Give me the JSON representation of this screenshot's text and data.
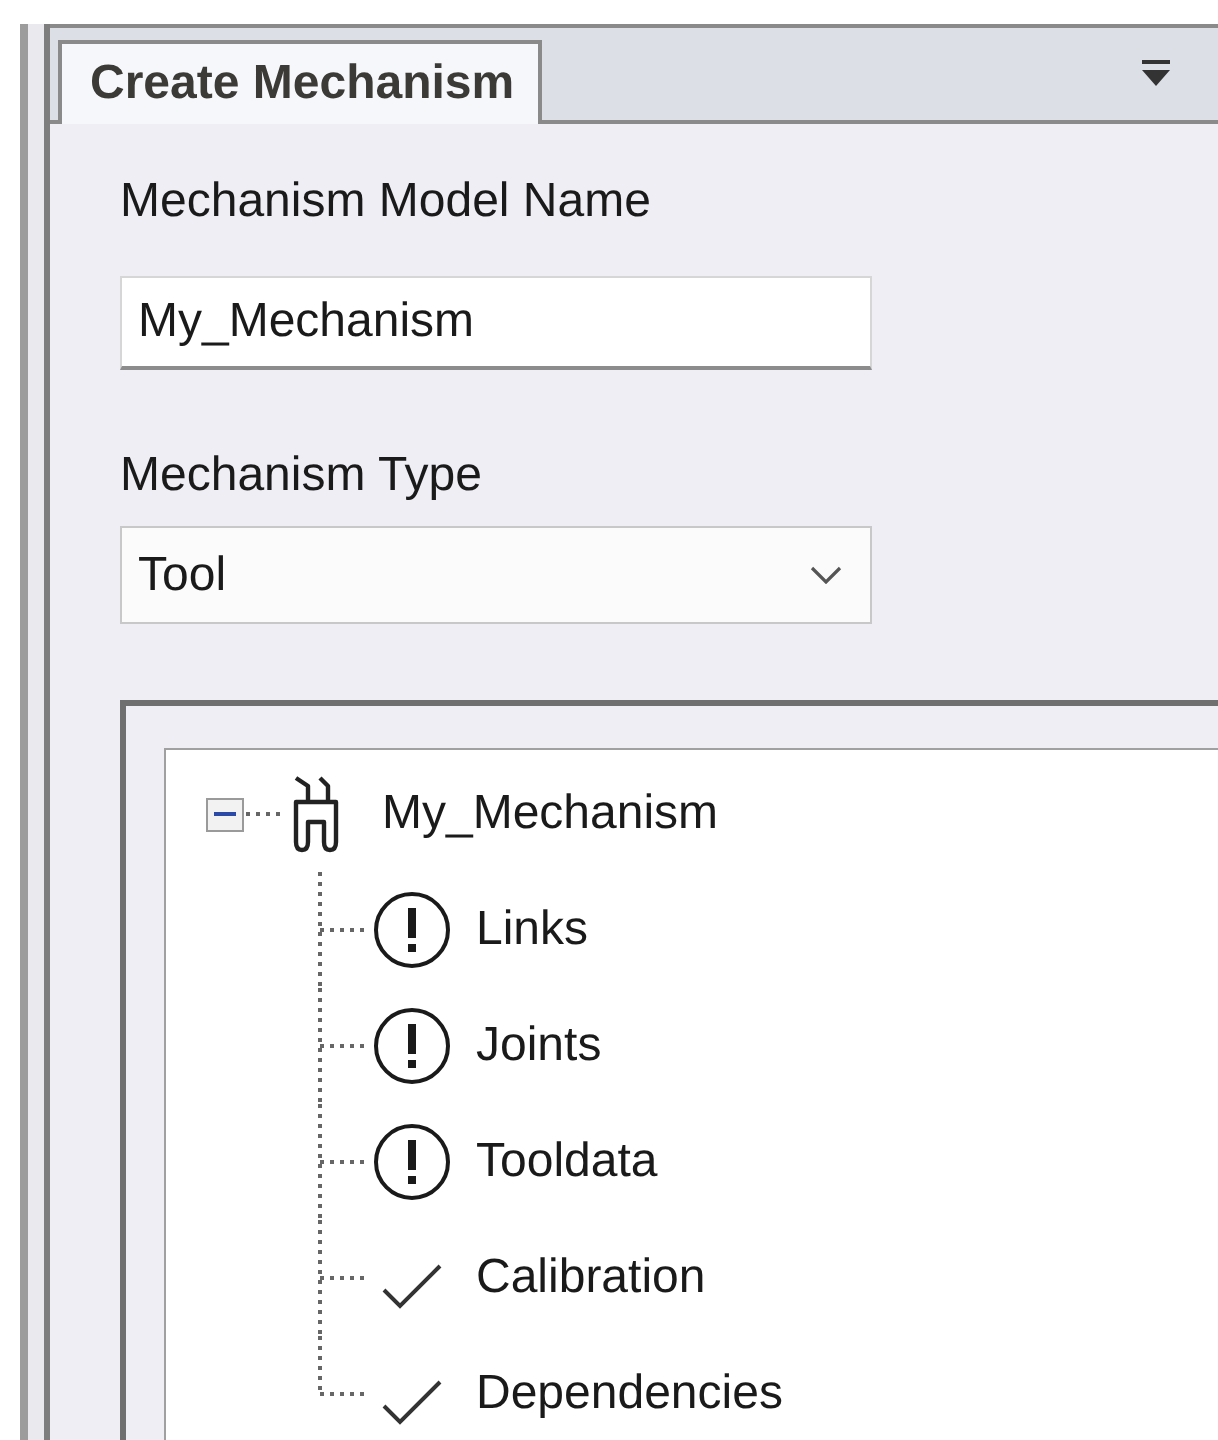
{
  "panel_tab": {
    "label": "Create Mechanism",
    "selected": true
  },
  "model_name": {
    "label": "Mechanism Model Name",
    "value": "My_Mechanism"
  },
  "mechanism_type": {
    "label": "Mechanism Type",
    "value": "Tool"
  },
  "tree": {
    "label": "My_Mechanism",
    "expanded": true,
    "children": [
      {
        "label": "Links",
        "kind": "incomplete"
      },
      {
        "label": "Joints",
        "kind": "incomplete"
      },
      {
        "label": "Tooldata",
        "kind": "incomplete"
      },
      {
        "label": "Calibration",
        "kind": "complete"
      },
      {
        "label": "Dependencies",
        "kind": "complete"
      }
    ]
  }
}
